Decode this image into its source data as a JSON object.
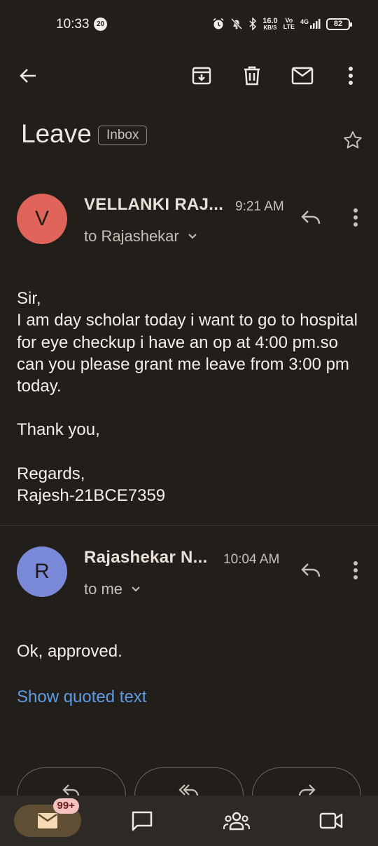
{
  "status_bar": {
    "time": "10:33",
    "notification_count": "20",
    "net_speed_value": "16.0",
    "net_speed_unit": "KB/S",
    "volte_top": "Vo",
    "volte_bottom": "LTE",
    "network": "4G",
    "battery": "82"
  },
  "toolbar": {
    "icons": [
      "back-arrow-icon",
      "archive-icon",
      "delete-icon",
      "mail-unread-icon",
      "more-vert-icon"
    ]
  },
  "email": {
    "subject": "Leave",
    "label": "Inbox",
    "messages": [
      {
        "avatar_letter": "V",
        "avatar_color": "#e0645a",
        "sender": "VELLANKI RAJ...",
        "time": "9:21 AM",
        "recipient": "to Rajashekar",
        "body": [
          "Sir,",
          "I am day scholar today i want to go to hospital for eye checkup  i have an op at 4:00 pm.so can you please grant me leave from 3:00 pm today.",
          "",
          "Thank you,",
          "",
          "Regards,",
          "Rajesh-21BCE7359"
        ]
      },
      {
        "avatar_letter": "R",
        "avatar_color": "#7b8ad8",
        "sender": "Rajashekar N...",
        "time": "10:04 AM",
        "recipient": "to me",
        "body": [
          "Ok, approved."
        ],
        "show_quoted": "Show quoted text"
      }
    ]
  },
  "reply_actions": [
    "reply-icon",
    "reply-all-icon",
    "forward-icon"
  ],
  "bottom_nav": {
    "items": [
      "mail-icon",
      "chat-icon",
      "spaces-icon",
      "meet-icon"
    ],
    "mail_badge": "99+",
    "active_color": "#5f4d34"
  },
  "colors": {
    "background": "#221f1b",
    "link": "#5e9be6"
  }
}
